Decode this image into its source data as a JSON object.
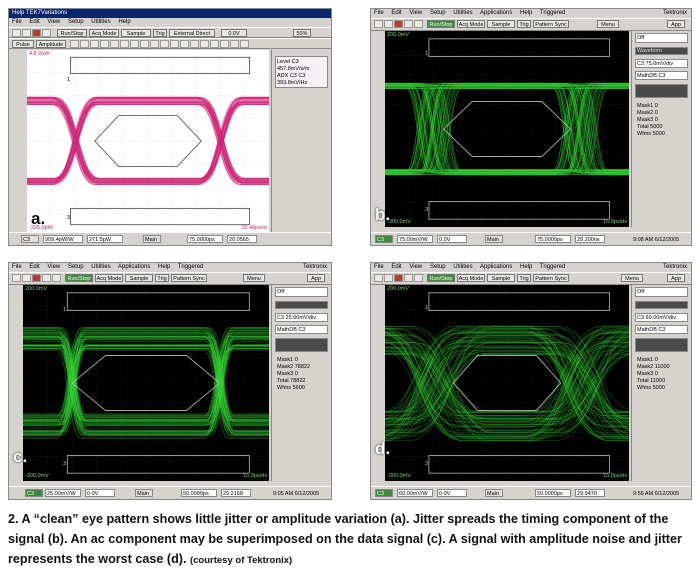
{
  "figure": {
    "caption": "2. A “clean” eye pattern shows little jitter or amplitude variation (a). Jitter spreads the timing component of the signal (b). An ac component may be superimposed on the data signal (c). A signal with amplitude noise and jitter represents the worst case (d).",
    "credit": "(courtesy of Tektronix)"
  },
  "panels": [
    {
      "letter": "a.",
      "menu": [
        "File",
        "Edit",
        "View",
        "Setup",
        "Utilities",
        "Help"
      ],
      "title_fragment": "Help TEK7Variations",
      "toolbar": {
        "run": "Run/Stop",
        "acq": "Acq Mode",
        "mode": "Sample",
        "trig": "Trig",
        "trig_src": "External Direct",
        "level": "0.0V",
        "pct": "50%",
        "pulse": "Pulse",
        "amp": "Amplitude"
      },
      "side": {
        "r1": "Level C3",
        "r2": "457.8mV/s/m",
        "r3": "ADX C3  C3",
        "r4": "393.8mV/Hz"
      },
      "top_left": "4.8 2pW",
      "bottom_left": "-225.0pW",
      "bottom_right": "15.40ps/m",
      "marker": "1",
      "marker2": "3",
      "bottom": {
        "ch": "C3",
        "f1": "909.4pW/W",
        "f2": "271.5pW",
        "main": "Main",
        "f3": "75.0000ps",
        "f4": "20.0565"
      },
      "color": "#d0287a"
    },
    {
      "letter": "b.",
      "menu": [
        "File",
        "Edit",
        "View",
        "Setup",
        "Utilities",
        "Applications",
        "Help",
        "Triggered"
      ],
      "title_fragment": "Tektronix",
      "toolbar": {
        "run": "Run/Stop",
        "acq": "Acq Mode",
        "mode": "Sample",
        "trig": "Trig",
        "trig_src": "Pattern Sync",
        "menu": "Menu",
        "app": "App"
      },
      "side": {
        "r1": "Off",
        "r2": "Waveform",
        "r3": "C3 75.0mV/div",
        "r4": "MathDB C3",
        "m1": "Mask1  0",
        "m2": "Mask2  0",
        "m3": "Mask3  0",
        "tot": "Total  5000",
        "wf": "Wfms  5000"
      },
      "top_left": "200.0mV",
      "bottom_left": "-300.0mV",
      "bottom_right": "15.0ps/dv",
      "marker": "1",
      "marker2": "3",
      "bottom": {
        "ch": "C3",
        "f1": "75.00mV/W",
        "f2": "0.0V",
        "main": "Main",
        "f3": "75.0000ps",
        "f4": "29.200ns",
        "time": "9:08 AM 6/12/2005"
      },
      "color": "#3adf3a"
    },
    {
      "letter": "c.",
      "menu": [
        "File",
        "Edit",
        "View",
        "Setup",
        "Utilities",
        "Applications",
        "Help",
        "Triggered"
      ],
      "title_fragment": "Tektronix",
      "toolbar": {
        "run": "Run/Stop",
        "acq": "Acq Mode",
        "mode": "Sample",
        "trig": "Trig",
        "trig_src": "Pattern Sync",
        "menu": "Menu",
        "app": "App"
      },
      "side": {
        "r1": "Off",
        "r2": "C3 25.00mV/div",
        "r3": "MathDB C3",
        "m1": "Mask1  0",
        "m2": "Mask2  78822",
        "m3": "Mask3  0",
        "tot": "Total  78822",
        "wf": "Wfms  5600"
      },
      "top_left": "200.0mV",
      "bottom_left": "-300.0mV",
      "bottom_right": "15.0ps/dv",
      "marker": "1",
      "marker2": "3",
      "bottom": {
        "ch": "C3",
        "f1": "25.00mV/W",
        "f2": "0.0V",
        "main": "Main",
        "f3": "50.0000ps",
        "f4": "29.2168",
        "time": "9:05 AM 6/12/2005"
      },
      "color": "#3adf3a"
    },
    {
      "letter": "d.",
      "menu": [
        "File",
        "Edit",
        "View",
        "Setup",
        "Utilities",
        "Applications",
        "Help",
        "Triggered"
      ],
      "title_fragment": "Tektronix",
      "toolbar": {
        "run": "Run/Stop",
        "acq": "Acq Mode",
        "mode": "Sample",
        "trig": "Trig",
        "trig_src": "Pattern Sync",
        "menu": "Menu",
        "app": "App"
      },
      "side": {
        "r1": "Off",
        "r2": "C3 60.00mV/div",
        "r3": "MathDB C3",
        "m1": "Mask1  0",
        "m2": "Mask2  11000",
        "m3": "Mask3  0",
        "tot": "Total  11000",
        "wf": "Wfms  5000"
      },
      "top_left": "200.0mV",
      "bottom_left": "-300.0mV",
      "bottom_right": "15.0ps/dv",
      "marker": "1",
      "marker2": "3",
      "bottom": {
        "ch": "C3",
        "f1": "60.00mV/W",
        "f2": "0.0V",
        "main": "Main",
        "f3": "50.0000ps",
        "f4": "29.9470",
        "time": "9:56 AM 6/12/2005"
      },
      "color": "#3adf3a"
    }
  ]
}
